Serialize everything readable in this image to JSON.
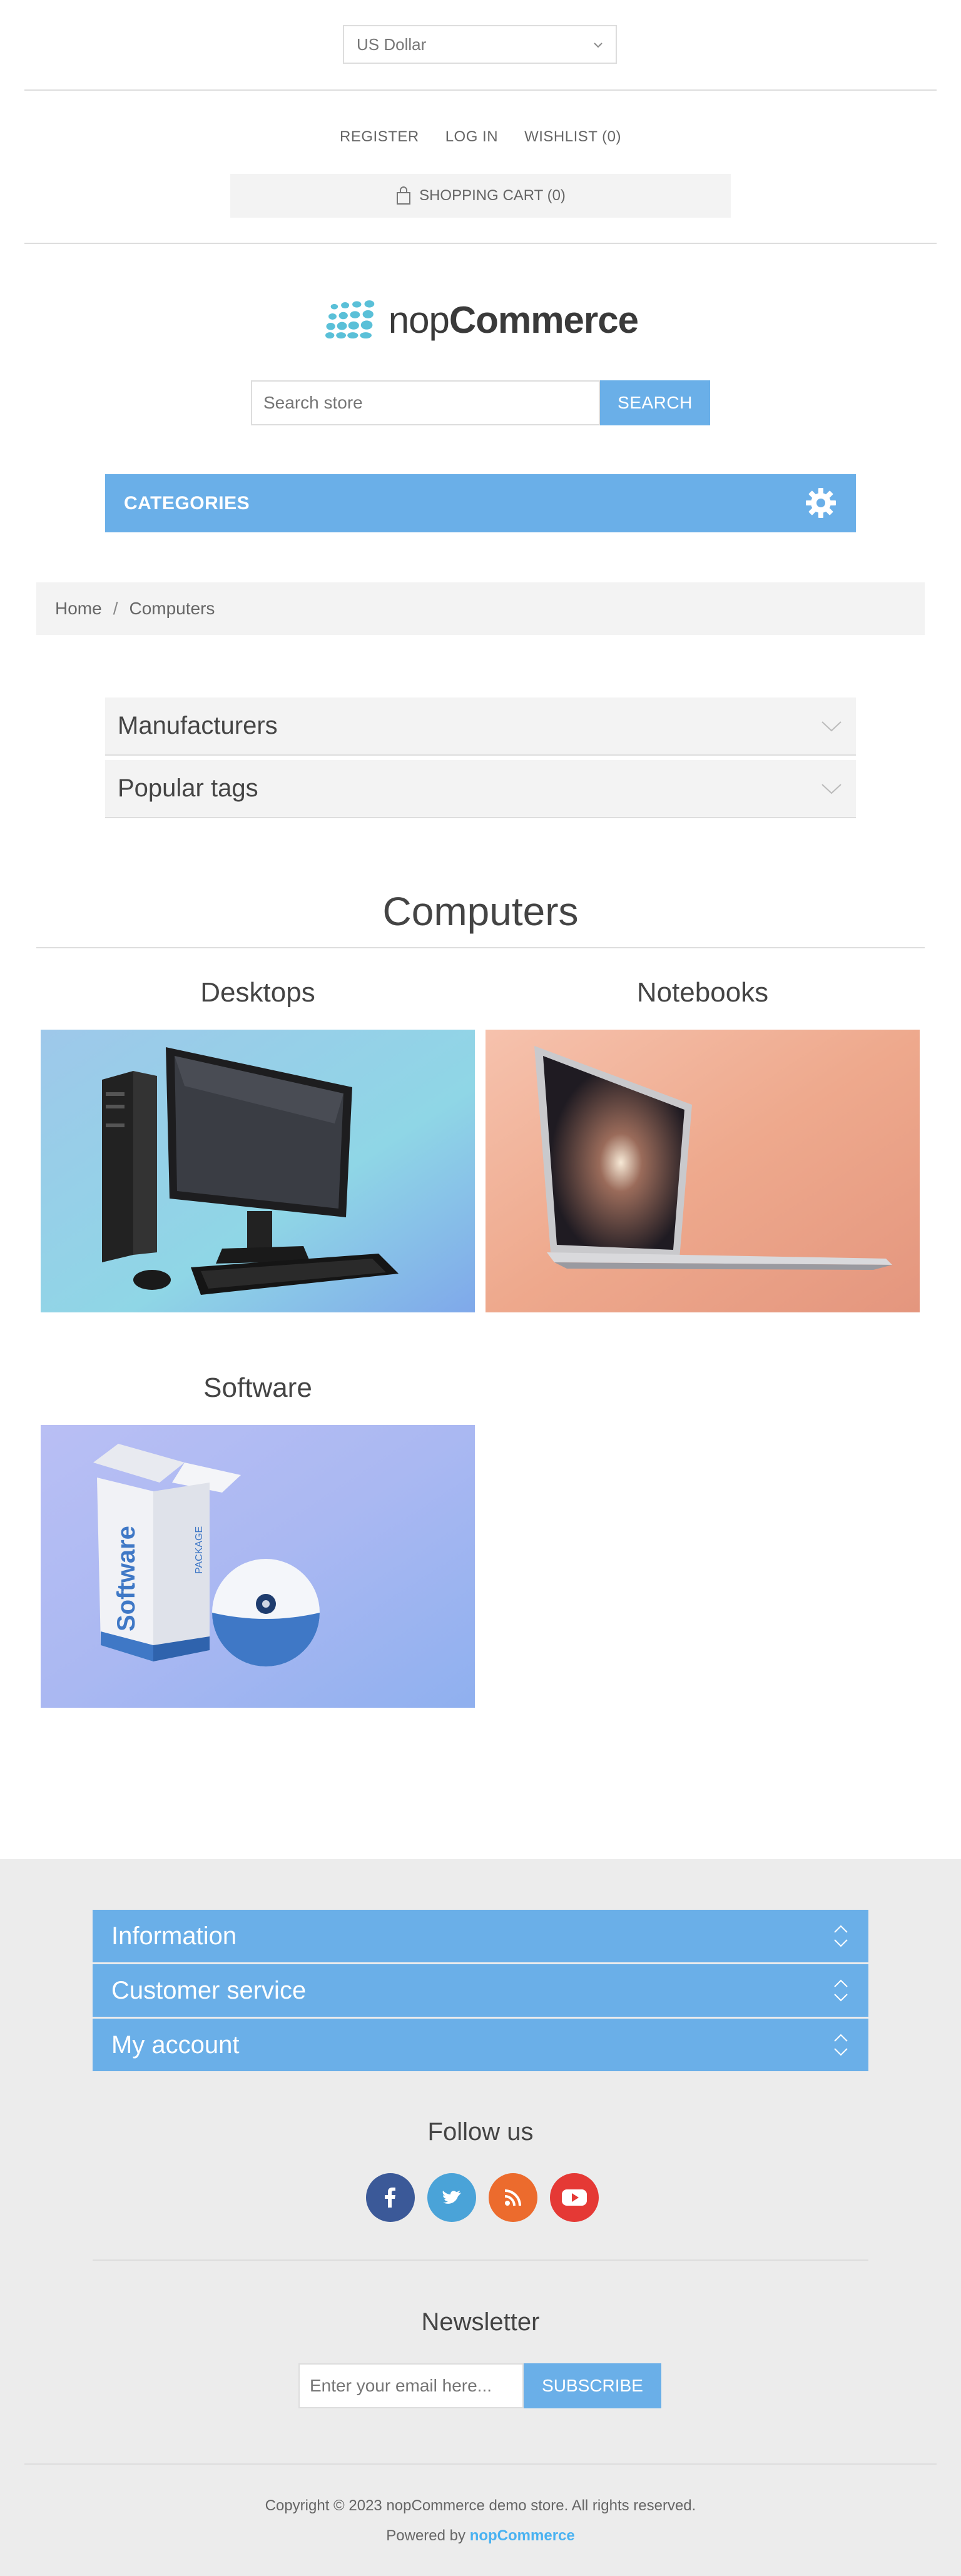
{
  "header": {
    "currency": "US Dollar",
    "links": [
      "REGISTER",
      "LOG IN",
      "WISHLIST (0)"
    ],
    "cart": "SHOPPING CART (0)",
    "logo_light": "nop",
    "logo_bold": "Commerce",
    "search_placeholder": "Search store",
    "search_button": "SEARCH",
    "categories": "CATEGORIES"
  },
  "breadcrumb": {
    "home": "Home",
    "separator": "/",
    "current": "Computers"
  },
  "filters": [
    "Manufacturers",
    "Popular tags"
  ],
  "page": {
    "title": "Computers",
    "subcategories": [
      "Desktops",
      "Notebooks",
      "Software"
    ]
  },
  "footer": {
    "sections": [
      "Information",
      "Customer service",
      "My account"
    ],
    "follow_us": "Follow us",
    "newsletter": "Newsletter",
    "newsletter_placeholder": "Enter your email here...",
    "subscribe": "SUBSCRIBE",
    "copyright": "Copyright © 2023 nopCommerce demo store. All rights reserved.",
    "powered_by": "Powered by",
    "powered_link": "nopCommerce"
  },
  "colors": {
    "accent": "#6aafe8",
    "footer_bg": "#ececec",
    "panel_bg": "#f3f3f3"
  },
  "icons": [
    "chevron-down-icon",
    "shopping-bag-icon",
    "gear-icon",
    "facebook-icon",
    "twitter-icon",
    "rss-icon",
    "youtube-icon"
  ]
}
